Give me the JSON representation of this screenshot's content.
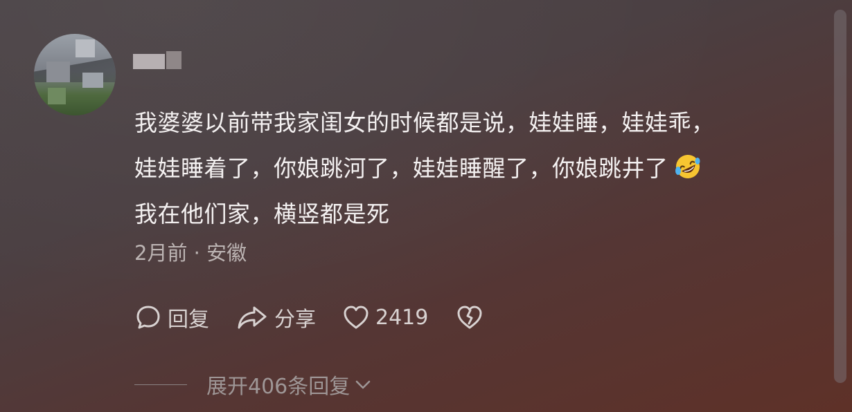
{
  "comment": {
    "line1": "我婆婆以前带我家闺女的时候都是说，娃娃睡，娃娃乖，",
    "line2": "娃娃睡着了，你娘跳河了，娃娃睡醒了，你娘跳井了",
    "line3": "我在他们家，横竖都是死",
    "emoji": "rofl-emoji"
  },
  "meta": {
    "time_location": "2月前 · 安徽"
  },
  "actions": {
    "reply_label": "回复",
    "share_label": "分享",
    "like_count": "2419",
    "dislike_icon": "broken-heart-icon"
  },
  "expand": {
    "label": "展开406条回复"
  },
  "colors": {
    "text": "#f4f1f1",
    "meta": "#bcb4b3",
    "action": "#d8d2d1",
    "expand": "#9e9696"
  }
}
